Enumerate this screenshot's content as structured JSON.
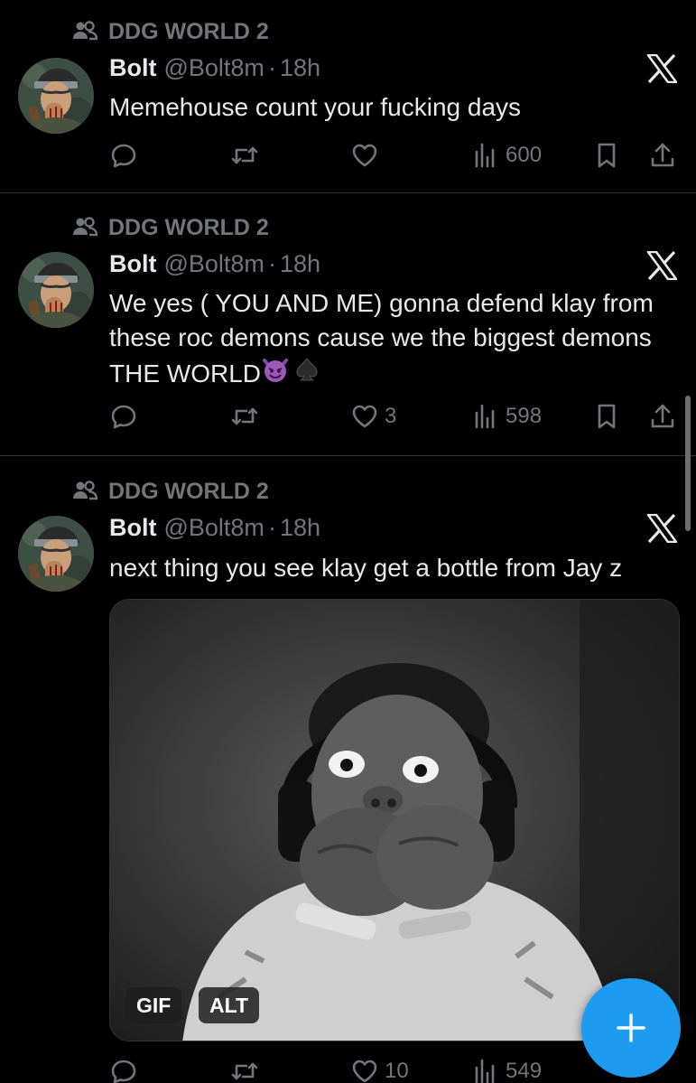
{
  "tweets": [
    {
      "community": "DDG WORLD 2",
      "name": "Bolt",
      "handle": "@Bolt8m",
      "dot": "·",
      "time": "18h",
      "text": "Memehouse count your fucking days",
      "likes": "",
      "views": "600"
    },
    {
      "community": "DDG WORLD 2",
      "name": "Bolt",
      "handle": "@Bolt8m",
      "dot": "·",
      "time": "18h",
      "text_line1": "We yes ( YOU AND ME) gonna defend klay from",
      "text_line2": "these roc demons cause we the biggest demons",
      "text_line3": "THE WORLD",
      "emojis": [
        "smiling-imp-emoji",
        "spade-suit-emoji"
      ],
      "likes": "3",
      "views": "598"
    },
    {
      "community": "DDG WORLD 2",
      "name": "Bolt",
      "handle": "@Bolt8m",
      "dot": "·",
      "time": "18h",
      "text": "next thing you see klay get a bottle from Jay z",
      "media": {
        "type": "gif",
        "gif_label": "GIF",
        "alt_label": "ALT"
      },
      "likes": "10",
      "views": "549"
    }
  ],
  "icons": {
    "community": "community-icon",
    "reply": "reply-icon",
    "retweet": "retweet-icon",
    "like": "heart-icon",
    "views": "views-icon",
    "bookmark": "bookmark-icon",
    "share": "share-icon",
    "x": "x-logo-icon",
    "compose": "plus-icon"
  },
  "colors": {
    "background": "#000000",
    "text": "#e7e9ea",
    "secondary": "#71767b",
    "accent": "#1d9bf0",
    "divider": "#2f3336"
  }
}
